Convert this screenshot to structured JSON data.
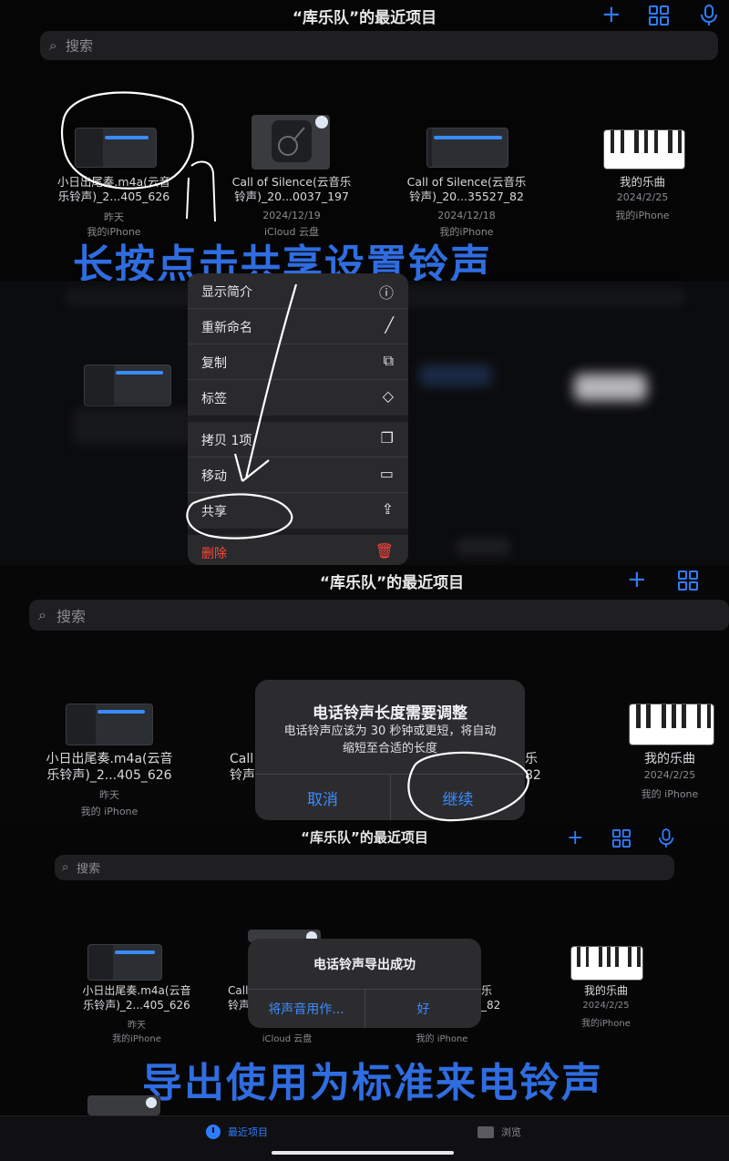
{
  "screen1": {
    "title": "“库乐队”的最近项目",
    "search_placeholder": "搜索",
    "files": [
      {
        "name_line1": "小日出尾奏.m4a(云音",
        "name_line2": "乐铃声)_2...405_626",
        "date": "昨天",
        "location": "我的iPhone"
      },
      {
        "name_line1": "Call of Silence(云音乐",
        "name_line2": "铃声)_20...0037_197",
        "date": "2024/12/19",
        "location": "iCloud 云盘"
      },
      {
        "name_line1": "Call of Silence(云音乐",
        "name_line2": "铃声)_20...35527_82",
        "date": "2024/12/18",
        "location": "我的iPhone"
      },
      {
        "name_line1": "我的乐曲",
        "name_line2": "",
        "date": "2024/2/25",
        "location": "我的iPhone"
      }
    ],
    "annotation": "长按点击共享设置铃声",
    "annotation_mark": "fn"
  },
  "context_menu": {
    "items": [
      {
        "label": "显示简介",
        "icon": "info-circle-icon",
        "glyph": "ⓘ"
      },
      {
        "label": "重新命名",
        "icon": "pencil-icon",
        "glyph": "╱"
      },
      {
        "label": "复制",
        "icon": "duplicate-icon",
        "glyph": "⧉"
      },
      {
        "label": "标签",
        "icon": "tag-icon",
        "glyph": "◇"
      },
      {
        "label": "拷贝 1项",
        "icon": "copy-icon",
        "glyph": "❐"
      },
      {
        "label": "移动",
        "icon": "folder-icon",
        "glyph": "▭"
      },
      {
        "label": "共享",
        "icon": "share-icon",
        "glyph": "⇪"
      },
      {
        "label": "删除",
        "icon": "trash-icon",
        "glyph": "🗑"
      }
    ]
  },
  "screen2": {
    "title": "“库乐队”的最近项目",
    "search_placeholder": "搜索",
    "files": [
      {
        "name_line1": "小日出尾奏.m4a(云音",
        "name_line2": "乐铃声)_2...405_626",
        "date": "昨天",
        "location": "我的 iPhone"
      },
      {
        "name_line1": "Call",
        "name_line2": "铃声",
        "date": "",
        "location": ""
      },
      {
        "name_line1": "乐",
        "name_line2": "82",
        "date": "",
        "location": ""
      },
      {
        "name_line1": "我的乐曲",
        "name_line2": "",
        "date": "2024/2/25",
        "location": "我的 iPhone"
      }
    ],
    "alert": {
      "title": "电话铃声长度需要调整",
      "message_line1": "电话铃声应该为 30 秒钟或更短，将自动",
      "message_line2": "缩短至合适的长度",
      "cancel": "取消",
      "continue": "继续"
    }
  },
  "screen3": {
    "title": "“库乐队”的最近项目",
    "search_placeholder": "搜索",
    "files": [
      {
        "name_line1": "小日出尾奏.m4a(云音",
        "name_line2": "乐铃声)_2...405_626",
        "date": "昨天",
        "location": "我的iPhone"
      },
      {
        "name_line1": "Call",
        "name_line2": "铃声",
        "date": "",
        "location": "iCloud 云盘"
      },
      {
        "name_line1": "乐",
        "name_line2": "_82",
        "date": "",
        "location": "我的 iPhone"
      },
      {
        "name_line1": "我的乐曲",
        "name_line2": "",
        "date": "2024/2/25",
        "location": "我的iPhone"
      }
    ],
    "alert": {
      "title": "电话铃声导出成功",
      "use_sound": "将声音用作...",
      "ok": "好"
    },
    "annotation": "导出使用为标准来电铃声",
    "tabs": [
      {
        "label": "最近项目",
        "icon": "clock-icon",
        "active": true
      },
      {
        "label": "浏览",
        "icon": "folder-icon",
        "active": false
      }
    ]
  },
  "colors": {
    "accent": "#2f7dff",
    "annotation": "#2f6de0",
    "destructive": "#ff453a",
    "background": "#050506"
  }
}
